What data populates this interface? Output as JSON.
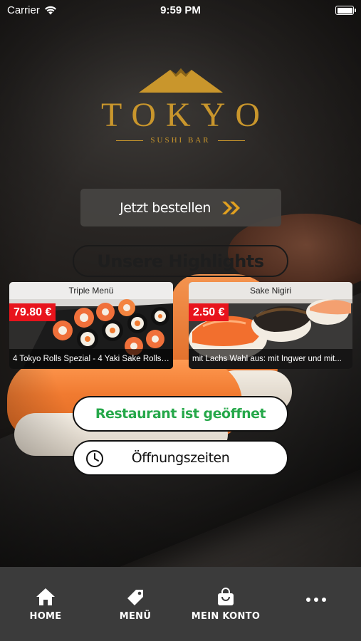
{
  "status_bar": {
    "carrier": "Carrier",
    "time": "9:59 PM"
  },
  "logo": {
    "name": "TOKYO",
    "subtitle": "SUSHI BAR"
  },
  "order_button": {
    "label": "Jetzt bestellen"
  },
  "highlights": {
    "title": "Unsere Highlights",
    "items": [
      {
        "title": "Triple Menü",
        "price": "79.80 €",
        "description": "4 Tokyo Rolls Spezial - 4 Yaki Sake Rolls ..."
      },
      {
        "title": "Sake Nigiri",
        "price": "2.50 €",
        "description": "mit Lachs Wahl aus: mit Ingwer und mit..."
      }
    ]
  },
  "status_pill": {
    "label": "Restaurant ist geöffnet"
  },
  "hours_pill": {
    "label": "Öffnungszeiten"
  },
  "tabbar": {
    "items": [
      {
        "label": "HOME",
        "icon": "home-icon"
      },
      {
        "label": "MENÜ",
        "icon": "tag-icon"
      },
      {
        "label": "MEIN KONTO",
        "icon": "shopping-bag-icon"
      },
      {
        "label": "",
        "icon": "more-icon"
      }
    ]
  },
  "colors": {
    "gold": "#c9962c",
    "price_red": "#e8141c",
    "open_green": "#26a84a",
    "tabbar_bg": "#3b3b3b"
  }
}
